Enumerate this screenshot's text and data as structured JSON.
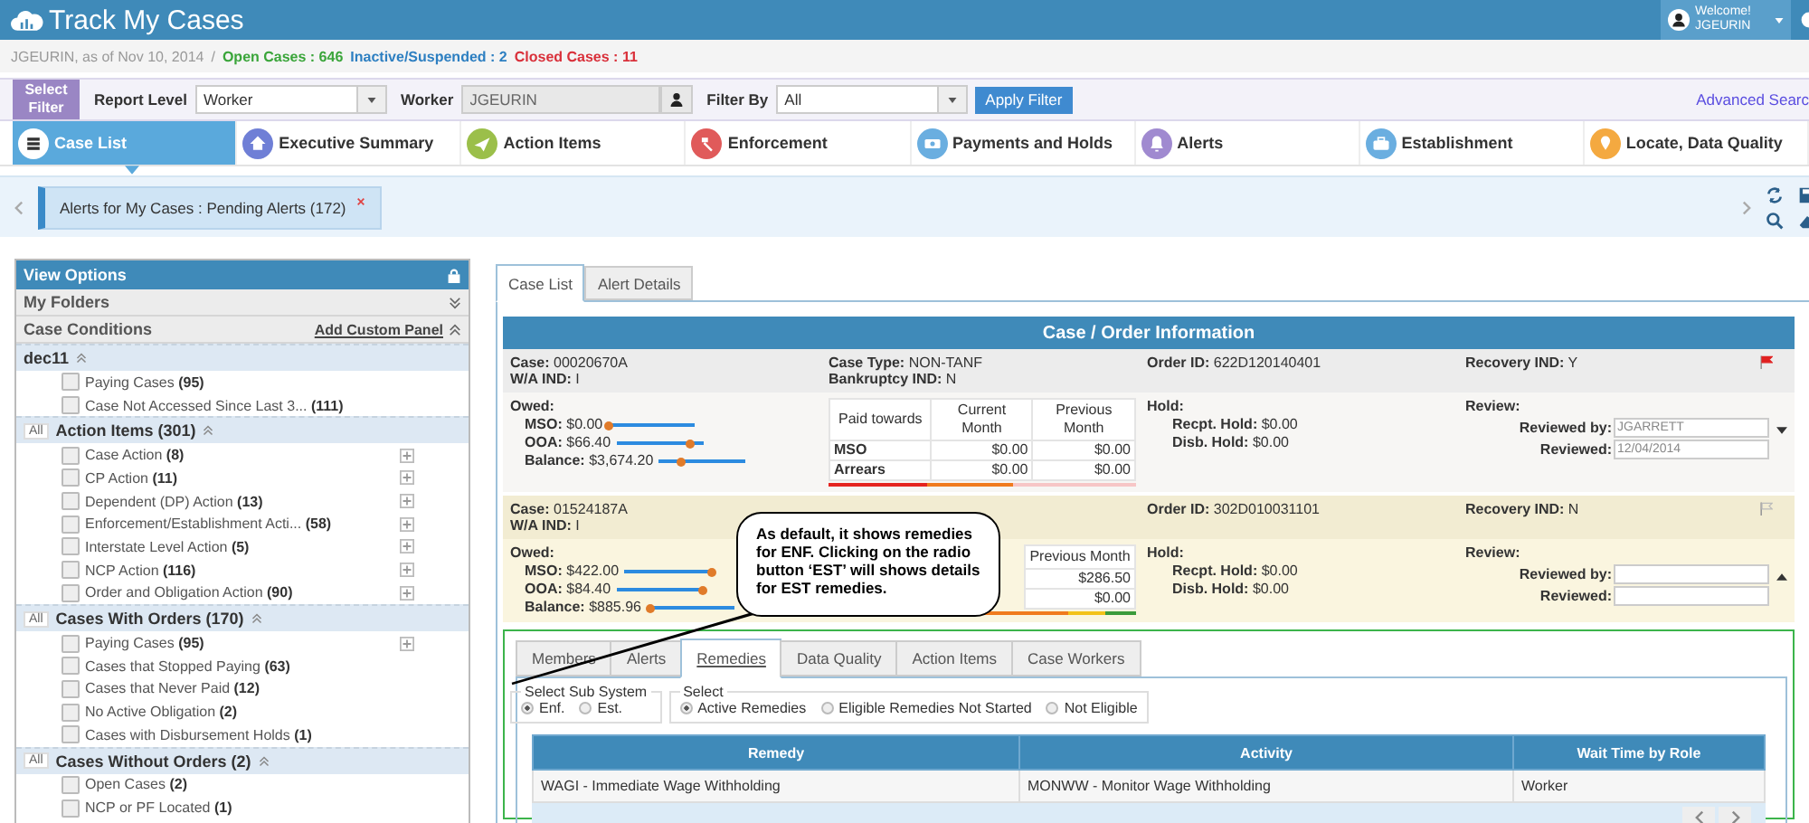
{
  "header": {
    "title": "Track My Cases",
    "welcome": "Welcome!",
    "user": "JGEURIN"
  },
  "summary": {
    "as_of": "JGEURIN, as of Nov 10, 2014",
    "separator": "/",
    "stats": [
      {
        "text": "Open Cases : 646",
        "color": "#3aa53a"
      },
      {
        "text": "Inactive/Suspended : 2",
        "color": "#2d7fc1"
      },
      {
        "text": "Closed Cases : 11",
        "color": "#d9303a"
      }
    ]
  },
  "filter": {
    "select_filter": "Select Filter",
    "report_level_label": "Report Level",
    "report_level": "Worker",
    "worker_label": "Worker",
    "worker": "JGEURIN",
    "filter_by_label": "Filter By",
    "filter_by": "All",
    "apply": "Apply Filter",
    "advanced": "Advanced Searc"
  },
  "nav_tabs": [
    {
      "label": "Case List",
      "selected": true,
      "color": "#ffffff"
    },
    {
      "label": "Executive Summary",
      "selected": false,
      "color": "#6f7fd6"
    },
    {
      "label": "Action Items",
      "selected": false,
      "color": "#9bbf4a"
    },
    {
      "label": "Enforcement",
      "selected": false,
      "color": "#e05a5a"
    },
    {
      "label": "Payments and Holds",
      "selected": false,
      "color": "#6aaee0"
    },
    {
      "label": "Alerts",
      "selected": false,
      "color": "#a08ad0"
    },
    {
      "label": "Establishment",
      "selected": false,
      "color": "#6aaee0"
    },
    {
      "label": "Locate, Data Quality",
      "selected": false,
      "color": "#f4a940"
    }
  ],
  "alerts_bar": {
    "chip": "Alerts for My Cases : Pending Alerts (172)"
  },
  "view_options": {
    "title": "View Options",
    "my_folders": "My Folders",
    "case_conditions": "Case Conditions",
    "add_custom_panel": "Add Custom Panel",
    "groups": [
      {
        "title": "dec11",
        "items": [
          {
            "label": "Paying Cases **(95)**",
            "checked": false,
            "expandable": false
          },
          {
            "label": "Case Not Accessed Since Last 3... **(111)**",
            "checked": false,
            "expandable": false
          }
        ]
      },
      {
        "all_label": "All",
        "title": "Action Items (301)",
        "items": [
          {
            "label": "Case Action **(8)**",
            "checked": false,
            "expandable": true
          },
          {
            "label": "CP Action **(11)**",
            "checked": false,
            "expandable": true
          },
          {
            "label": "Dependent (DP) Action **(13)**",
            "checked": false,
            "expandable": true
          },
          {
            "label": "Enforcement/Establishment Acti... **(58)**",
            "checked": false,
            "expandable": true
          },
          {
            "label": "Interstate Level Action **(5)**",
            "checked": false,
            "expandable": true
          },
          {
            "label": "NCP Action **(116)**",
            "checked": false,
            "expandable": true
          },
          {
            "label": "Order and Obligation Action **(90)**",
            "checked": false,
            "expandable": true
          }
        ]
      },
      {
        "all_label": "All",
        "title": "Cases With Orders (170)",
        "items": [
          {
            "label": "Paying Cases **(95)**",
            "checked": false,
            "expandable": true
          },
          {
            "label": "Cases that Stopped Paying **(63)**",
            "checked": false,
            "expandable": false
          },
          {
            "label": "Cases that Never Paid **(12)**",
            "checked": false,
            "expandable": false
          },
          {
            "label": "No Active Obligation **(2)**",
            "checked": false,
            "expandable": false
          },
          {
            "label": "Cases with Disbursement Holds **(1)**",
            "checked": false,
            "expandable": false
          }
        ]
      },
      {
        "all_label": "All",
        "title": "Cases Without Orders (2)",
        "items": [
          {
            "label": "Open Cases **(2)**",
            "checked": false,
            "expandable": false
          },
          {
            "label": "NCP or PF Located **(1)**",
            "checked": false,
            "expandable": false
          }
        ]
      }
    ]
  },
  "main_tabs": [
    {
      "label": "Case List",
      "selected": true
    },
    {
      "label": "Alert Details",
      "selected": false
    }
  ],
  "case_panel": {
    "title": "Case / Order Information",
    "cases": [
      {
        "selected": false,
        "flagged": true,
        "expanded": false,
        "id_fields": [
          {
            "label": "Case:",
            "value": "00020670A"
          },
          {
            "label": "W/A IND:",
            "value": "I"
          }
        ],
        "type_fields": [
          {
            "label": "Case Type:",
            "value": "NON-TANF"
          },
          {
            "label": "Bankruptcy IND:",
            "value": "N"
          }
        ],
        "order": {
          "label": "Order ID:",
          "value": "622D120140401"
        },
        "recovery": {
          "label": "Recovery IND:",
          "value": "Y"
        },
        "owed_label": "Owed:",
        "owed": [
          {
            "label": "MSO:",
            "value": "$0.00",
            "level": 0
          },
          {
            "label": "OOA:",
            "value": "$66.40",
            "level": 0.85
          },
          {
            "label": "Balance:",
            "value": "$3,674.20",
            "level": 0.25
          }
        ],
        "payments": {
          "columns": [
            "Paid towards",
            "Current Month",
            "Previous Month"
          ],
          "rows": [
            [
              "MSO",
              "$0.00",
              "$0.00"
            ],
            [
              "Arrears",
              "$0.00",
              "$0.00"
            ]
          ]
        },
        "hold_label": "Hold:",
        "holds": [
          {
            "label": "Recpt. Hold:",
            "value": "$0.00"
          },
          {
            "label": "Disb. Hold:",
            "value": "$0.00"
          }
        ],
        "review_label": "Review:",
        "reviewed_by": {
          "label": "Reviewed by:",
          "value": "JGARRETT"
        },
        "reviewed": {
          "label": "Reviewed:",
          "value": "12/04/2014"
        }
      },
      {
        "selected": true,
        "flagged": false,
        "expanded": true,
        "id_fields": [
          {
            "label": "Case:",
            "value": "01524187A"
          },
          {
            "label": "W/A IND:",
            "value": "I"
          }
        ],
        "order": {
          "label": "Order ID:",
          "value": "302D010031101"
        },
        "recovery": {
          "label": "Recovery IND:",
          "value": "N"
        },
        "owed_label": "Owed:",
        "owed": [
          {
            "label": "MSO:",
            "value": "$422.00",
            "level": 1
          },
          {
            "label": "OOA:",
            "value": "$84.40",
            "level": 1
          },
          {
            "label": "Balance:",
            "value": "$885.96",
            "level": 0.05
          }
        ],
        "payments": {
          "columns": [
            "Previous Month"
          ],
          "rows": [
            [
              "$286.50"
            ],
            [
              "$0.00"
            ]
          ]
        },
        "hold_label": "Hold:",
        "holds": [
          {
            "label": "Recpt. Hold:",
            "value": "$0.00"
          },
          {
            "label": "Disb. Hold:",
            "value": "$0.00"
          }
        ],
        "review_label": "Review:",
        "reviewed_by": {
          "label": "Reviewed by:"
        },
        "reviewed": {
          "label": "Reviewed:"
        }
      }
    ]
  },
  "callout": "As default, it shows remedies for ENF. Clicking on the radio button ‘EST’ will shows details for EST remedies.",
  "detail_tabs": [
    {
      "label": "Members",
      "selected": false
    },
    {
      "label": "Alerts",
      "selected": false
    },
    {
      "label": "Remedies",
      "selected": true
    },
    {
      "label": "Data Quality",
      "selected": false
    },
    {
      "label": "Action Items",
      "selected": false
    },
    {
      "label": "Case Workers",
      "selected": false
    }
  ],
  "sub_system": {
    "legend": "Select Sub System",
    "options": [
      {
        "label": "Enf.",
        "selected": true
      },
      {
        "label": "Est.",
        "selected": false
      }
    ]
  },
  "remedy_filter": {
    "legend": "Select",
    "options": [
      {
        "label": "Active Remedies",
        "selected": true
      },
      {
        "label": "Eligible Remedies Not Started",
        "selected": false
      },
      {
        "label": "Not Eligible",
        "selected": false
      }
    ]
  },
  "remedies": {
    "columns": [
      "Remedy",
      "Activity",
      "Wait Time by Role"
    ],
    "rows": [
      [
        "WAGI - Immediate Wage Withholding",
        "MONWW - Monitor Wage Withholding",
        "Worker"
      ]
    ]
  }
}
